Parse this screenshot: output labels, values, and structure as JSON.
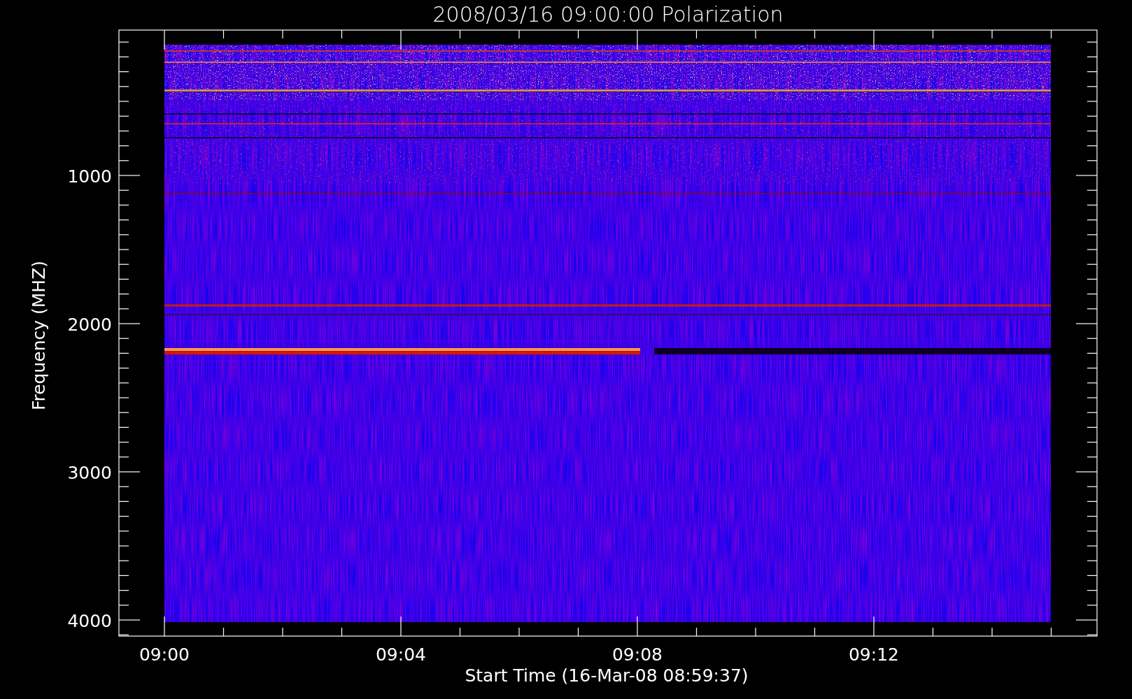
{
  "plot": {
    "title": "2008/03/16 09:00:00 Polarization",
    "ylabel": "Frequency (MHZ)",
    "xlabel": "Start Time (16-Mar-08 08:59:37)",
    "yticks": [
      "1000",
      "2000",
      "3000",
      "4000"
    ],
    "xticks": [
      "09:00",
      "09:04",
      "09:08",
      "09:12"
    ]
  }
}
